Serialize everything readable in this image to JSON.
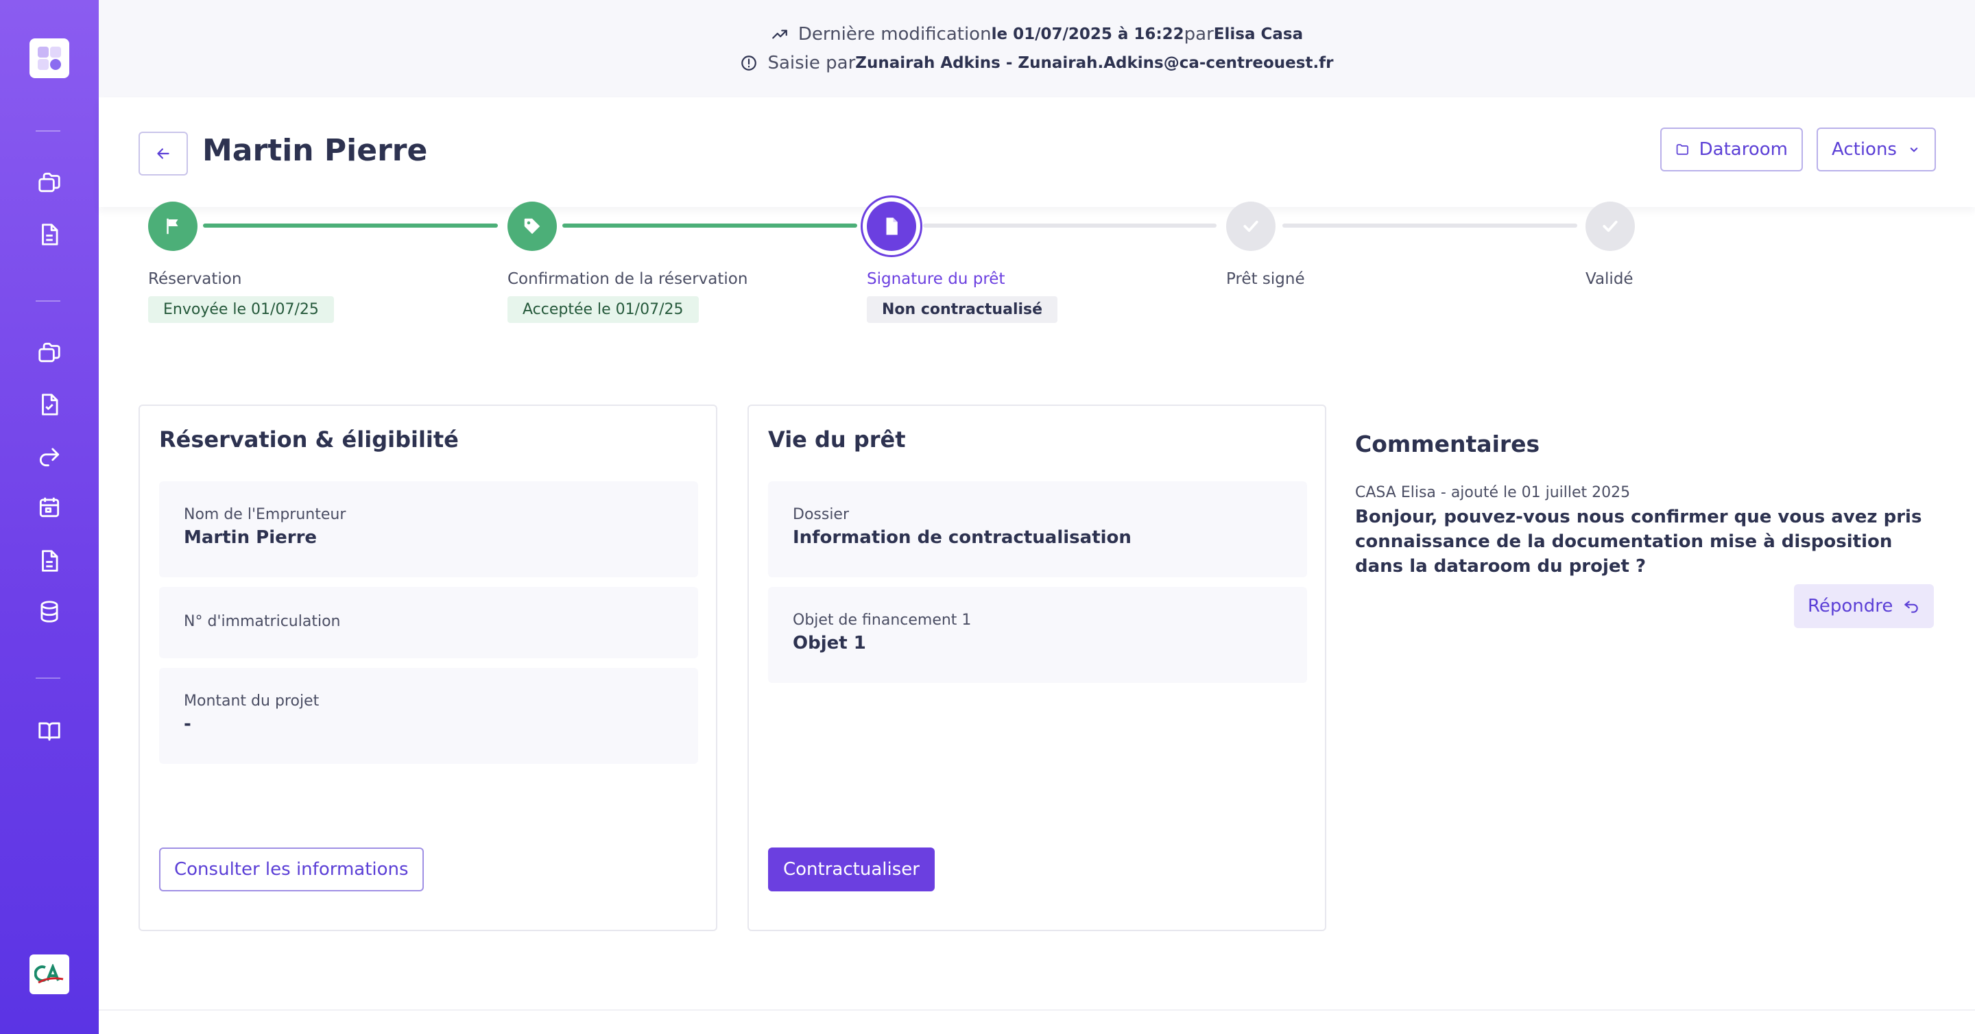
{
  "topbar": {
    "last_modified_label": "Dernière modification",
    "last_modified_date": "le 01/07/2025 à 16:22",
    "by_label": "par",
    "last_modified_by": "Elisa Casa",
    "entered_label": "Saisie par",
    "entered_by": "Zunairah Adkins - Zunairah.Adkins@ca-centreouest.fr"
  },
  "header": {
    "title": "Martin Pierre",
    "dataroom_label": "Dataroom",
    "actions_label": "Actions"
  },
  "stepper": {
    "steps": [
      {
        "label": "Réservation",
        "badge": "Envoyée le 01/07/25",
        "status": "done",
        "icon": "flag-icon"
      },
      {
        "label": "Confirmation de la réservation",
        "badge": "Acceptée le 01/07/25",
        "status": "done",
        "icon": "tag-icon"
      },
      {
        "label": "Signature du prêt",
        "badge": "Non contractualisé",
        "status": "current",
        "icon": "document-icon"
      },
      {
        "label": "Prêt signé",
        "badge": "",
        "status": "todo",
        "icon": "check-icon"
      },
      {
        "label": "Validé",
        "badge": "",
        "status": "todo",
        "icon": "check-icon"
      }
    ]
  },
  "reservation_card": {
    "title": "Réservation & éligibilité",
    "fields": [
      {
        "label": "Nom de l'Emprunteur",
        "value": "Martin Pierre"
      },
      {
        "label": "N° d'immatriculation",
        "value": ""
      },
      {
        "label": "Montant du projet",
        "value": "-"
      }
    ],
    "button_label": "Consulter les informations"
  },
  "loan_card": {
    "title": "Vie du prêt",
    "fields": [
      {
        "label": "Dossier",
        "value": "Information de contractualisation"
      },
      {
        "label": "Objet de financement 1",
        "value": "Objet 1"
      }
    ],
    "button_label": "Contractualiser"
  },
  "comments": {
    "title": "Commentaires",
    "items": [
      {
        "meta": "CASA Elisa - ajouté le 01 juillet 2025",
        "text": "Bonjour, pouvez-vous nous confirmer que vous avez pris connaissance de la documentation mise à disposition dans la dataroom du projet ?"
      }
    ],
    "reply_label": "Répondre"
  },
  "colors": {
    "accent": "#6b3fe0",
    "success": "#4caf78",
    "sidebar_top": "#8b5cf0",
    "sidebar_bottom": "#5b34e4"
  }
}
